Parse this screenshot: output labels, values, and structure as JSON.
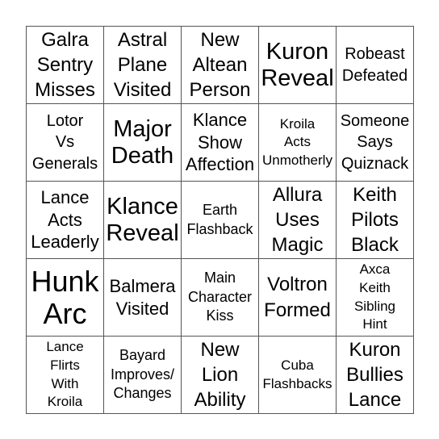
{
  "board": {
    "cells": [
      {
        "text": "Galra Sentry Misses",
        "lines": [
          "Galra",
          "Sentry",
          "Misses"
        ],
        "size": "s-m"
      },
      {
        "text": "Astral Plane Visited",
        "lines": [
          "Astral",
          "Plane",
          "Visited"
        ],
        "size": "s-m"
      },
      {
        "text": "New Altean Person",
        "lines": [
          "New",
          "Altean",
          "Person"
        ],
        "size": "s-m"
      },
      {
        "text": "Kuron Reveal",
        "lines": [
          "Kuron",
          "Reveal"
        ],
        "size": "s-l"
      },
      {
        "text": "Robeast Defeated",
        "lines": [
          "Robeast",
          "Defeated"
        ],
        "size": "s-s"
      },
      {
        "text": "Lotor Vs Generals",
        "lines": [
          "Lotor",
          "Vs",
          "Generals"
        ],
        "size": "s-s"
      },
      {
        "text": "Major Death",
        "lines": [
          "Major",
          "Death"
        ],
        "size": "s-l"
      },
      {
        "text": "Klance Show Affection",
        "lines": [
          "Klance",
          "Show",
          "Affection"
        ],
        "size": "s-ms"
      },
      {
        "text": "Kroila Acts Unmotherly",
        "lines": [
          "Kroila",
          "Acts",
          "Unmotherly"
        ],
        "size": "s-xxs"
      },
      {
        "text": "Someone Says Quiznack",
        "lines": [
          "Someone",
          "Says",
          "Quiznack"
        ],
        "size": "s-s"
      },
      {
        "text": "Lance Acts Leaderly",
        "lines": [
          "Lance",
          "Acts",
          "Leaderly"
        ],
        "size": "s-ms"
      },
      {
        "text": "Klance Reveal",
        "lines": [
          "Klance",
          "Reveal"
        ],
        "size": "s-l"
      },
      {
        "text": "Earth Flashback",
        "lines": [
          "Earth",
          "Flashback"
        ],
        "size": "s-xs"
      },
      {
        "text": "Allura Uses Magic",
        "lines": [
          "Allura",
          "Uses",
          "Magic"
        ],
        "size": "s-m"
      },
      {
        "text": "Keith Pilots Black",
        "lines": [
          "Keith",
          "Pilots",
          "Black"
        ],
        "size": "s-m"
      },
      {
        "text": "Hunk Arc",
        "lines": [
          "Hunk",
          "Arc"
        ],
        "size": "s-xl"
      },
      {
        "text": "Balmera Visited",
        "lines": [
          "Balmera",
          "Visited"
        ],
        "size": "s-ms"
      },
      {
        "text": "Main Character Kiss",
        "lines": [
          "Main",
          "Character",
          "Kiss"
        ],
        "size": "s-xs"
      },
      {
        "text": "Voltron Formed",
        "lines": [
          "Voltron",
          "Formed"
        ],
        "size": "s-m"
      },
      {
        "text": "Axca Keith Sibling Hint",
        "lines": [
          "Axca",
          "Keith",
          "Sibling",
          "Hint"
        ],
        "size": "s-xxs"
      },
      {
        "text": "Lance Flirts With Kroila",
        "lines": [
          "Lance",
          "Flirts",
          "With",
          "Kroila"
        ],
        "size": "s-xxs"
      },
      {
        "text": "Bayard Improves/ Changes",
        "lines": [
          "Bayard",
          "Improves/",
          "Changes"
        ],
        "size": "s-xs"
      },
      {
        "text": "New Lion Ability",
        "lines": [
          "New",
          "Lion",
          "Ability"
        ],
        "size": "s-m"
      },
      {
        "text": "Cuba Flashbacks",
        "lines": [
          "Cuba",
          "Flashbacks"
        ],
        "size": "s-xxs"
      },
      {
        "text": "Kuron Bullies Lance",
        "lines": [
          "Kuron",
          "Bullies",
          "Lance"
        ],
        "size": "s-m"
      }
    ]
  }
}
